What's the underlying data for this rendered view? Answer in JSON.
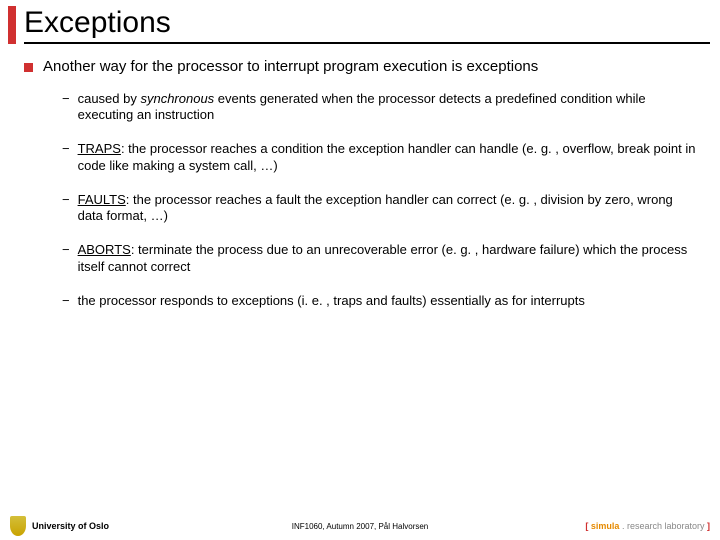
{
  "title": "Exceptions",
  "lvl1": "Another way for the processor to interrupt program execution is exceptions",
  "items": [
    {
      "pre": "caused by ",
      "ital": "synchronous",
      "post": " events generated when the processor detects a predefined condition while executing an instruction"
    },
    {
      "label": "TRAPS",
      "post": ": the processor reaches a condition the exception handler can handle (e. g. , overflow, break point in code like making a system call, …)"
    },
    {
      "label": "FAULTS",
      "post": ": the processor reaches a fault the exception handler can correct (e. g. , division by zero, wrong data format, …)"
    },
    {
      "label": "ABORTS",
      "post": ": terminate the process due to an unrecoverable error (e. g. , hardware failure) which the process itself cannot correct"
    },
    {
      "post": "the processor responds to exceptions (i. e. , traps and faults) essentially as for interrupts"
    }
  ],
  "footer": {
    "left": "University of Oslo",
    "center": "INF1060, Autumn 2007, Pål Halvorsen",
    "right_bracket_open": "[ ",
    "right_sim": "simula ",
    "right_dot": ". ",
    "right_lab": "research laboratory ",
    "right_bracket_close": "]"
  }
}
